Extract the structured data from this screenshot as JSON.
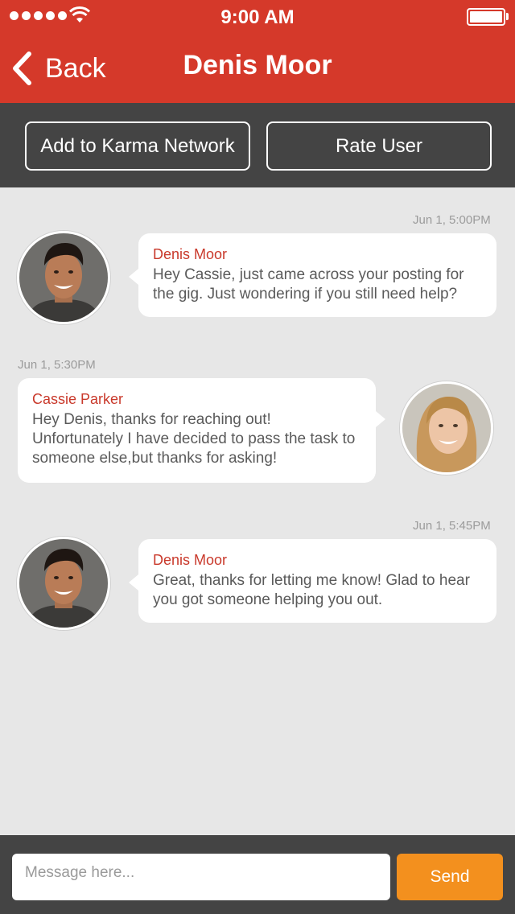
{
  "status_bar": {
    "time": "9:00 AM",
    "signal_icon": "signal-dots-icon",
    "wifi_icon": "wifi-icon",
    "battery_icon": "battery-icon",
    "battery_level": 1.0
  },
  "nav": {
    "back_label": "Back",
    "back_icon": "chevron-left-icon",
    "title": "Denis Moor"
  },
  "actions": {
    "add_label": "Add to Karma Network",
    "rate_label": "Rate User"
  },
  "messages": [
    {
      "timestamp": "Jun 1, 5:00PM",
      "sender": "Denis Moor",
      "text": "Hey Cassie, just came across your posting for the gig. Just wondering if you still need help?",
      "side": "left",
      "avatar": "avatar-denis"
    },
    {
      "timestamp": "Jun 1, 5:30PM",
      "sender": "Cassie Parker",
      "text": "Hey Denis, thanks for reaching out! Unfortunately I have decided to pass the task to someone else,but thanks for asking!",
      "side": "right",
      "avatar": "avatar-cassie"
    },
    {
      "timestamp": "Jun 1, 5:45PM",
      "sender": "Denis Moor",
      "text": "Great, thanks for letting me know! Glad to hear you got someone helping you out.",
      "side": "left",
      "avatar": "avatar-denis"
    }
  ],
  "composer": {
    "placeholder": "Message here...",
    "value": "",
    "send_label": "Send"
  },
  "colors": {
    "header_red": "#d5392a",
    "bar_dark": "#444444",
    "background": "#e7e7e7",
    "sender_red": "#c9392b",
    "send_orange": "#f3901e"
  }
}
